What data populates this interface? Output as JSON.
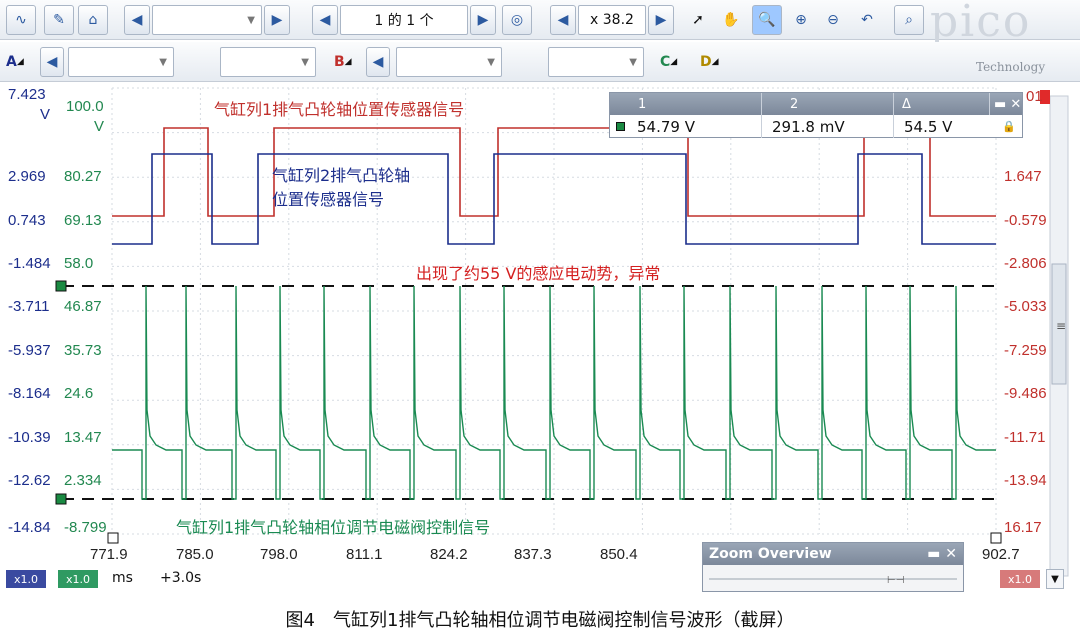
{
  "toolbar1": {
    "page_label": "1 的 1 个",
    "zoom_label": "x 38.2",
    "brand_logo": "pico",
    "brand_sub": "Technology"
  },
  "toolbar2": {
    "channel_a": "A",
    "channel_b": "B",
    "channel_c": "C",
    "channel_d": "D"
  },
  "colors": {
    "channel_a": "#1c2e8c",
    "channel_b": "#228850",
    "ref_red": "#c0302c"
  },
  "axes": {
    "left_a_top": "7.423",
    "left_a_unit": "V",
    "left_b_top": "100.0",
    "left_b_unit": "V",
    "left_a_ticks": [
      "2.969",
      "0.743",
      "-1.484",
      "-3.711",
      "-5.937",
      "-8.164",
      "-10.39",
      "-12.62",
      "-14.84"
    ],
    "left_b_ticks": [
      "80.27",
      "69.13",
      "58.0",
      "46.87",
      "35.73",
      "24.6",
      "13.47",
      "2.334",
      "-8.799"
    ],
    "right_ticks": [
      "1.647",
      "-0.579",
      "-2.806",
      "-5.033",
      "-7.259",
      "-9.486",
      "-11.71",
      "-13.94",
      "16.17"
    ],
    "right_top": "01",
    "x_ticks": [
      "771.9",
      "785.0",
      "798.0",
      "811.1",
      "824.2",
      "837.3",
      "850.4",
      "902.7"
    ]
  },
  "annotations": {
    "red_trace": "气缸列1排气凸轮轴位置传感器信号",
    "blue_trace_line1": "气缸列2排气凸轮轴",
    "blue_trace_line2": "位置传感器信号",
    "spike_note": "出现了约55 V的感应电动势，异常",
    "green_trace": "气缸列1排气凸轮轴相位调节电磁阀控制信号"
  },
  "ruler": {
    "col1": "1",
    "col2": "2",
    "col3": "Δ",
    "val1": "54.79 V",
    "val2": "291.8 mV",
    "val3": "54.5 V"
  },
  "zoom_overview": {
    "title": "Zoom Overview"
  },
  "status": {
    "badge_a": "x1.0",
    "badge_b": "x1.0",
    "unit": "ms",
    "offset": "+3.0s",
    "badge_r": "x1.0"
  },
  "caption": "图4　气缸列1排气凸轮轴相位调节电磁阀控制信号波形（截屏）"
}
